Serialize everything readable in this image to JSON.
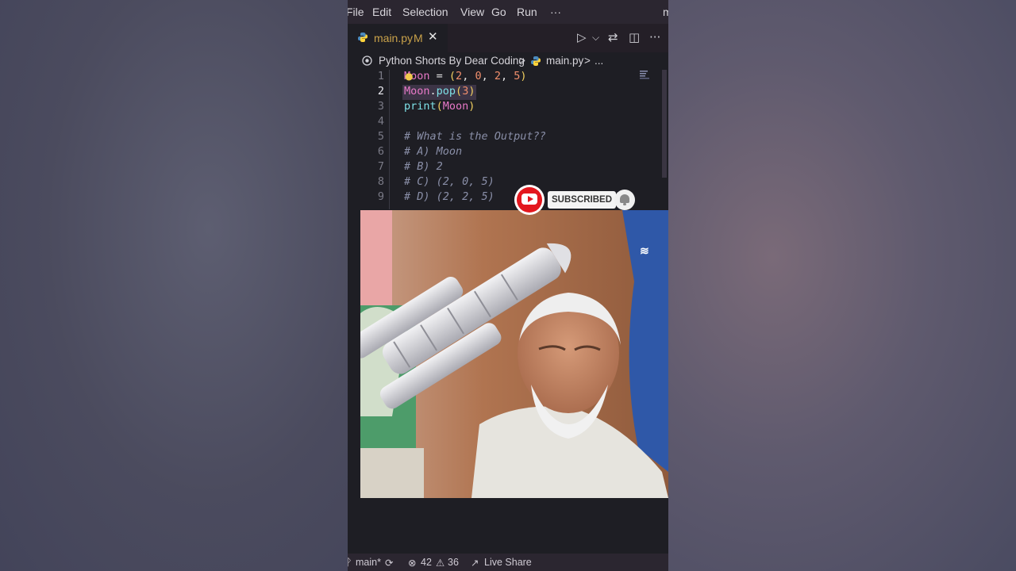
{
  "menubar": {
    "items": [
      "File",
      "Edit",
      "Selection",
      "View",
      "Go",
      "Run",
      "···"
    ],
    "trailing": "m"
  },
  "tab": {
    "filename": "main.py",
    "modified_badge": "M",
    "close_glyph": "✕"
  },
  "tab_actions": {
    "run_glyph": "▷",
    "run_menu_glyph": "⌵",
    "compare_glyph": "⇄",
    "split_glyph": "◫",
    "more_glyph": "···"
  },
  "breadcrumb": {
    "folder": "Python Shorts By Dear Coding",
    "separator": ">",
    "file": "main.py",
    "separator2": ">",
    "ellipsis": "..."
  },
  "editor": {
    "line_numbers": [
      "1",
      "2",
      "3",
      "4",
      "5",
      "6",
      "7",
      "8",
      "9"
    ],
    "active_line": "2",
    "lines": {
      "l1": {
        "var": "Moon",
        "eq": " = ",
        "open": "(",
        "v1": "2",
        "c1": ", ",
        "v2": "0",
        "c2": ", ",
        "v3": "2",
        "c3": ", ",
        "v4": "5",
        "close": ")"
      },
      "l2": {
        "obj": "Moon",
        "dot": ".",
        "method": "pop",
        "open": "(",
        "arg": "3",
        "close": ")"
      },
      "l3": {
        "fn": "print",
        "open": "(",
        "arg": "Moon",
        "close": ")"
      },
      "l5": "# What is the Output??",
      "l6": "# A) Moon",
      "l7": "# B) 2",
      "l8": "# C) (2, 0, 5)",
      "l9": "# D) (2, 2, 5)"
    }
  },
  "overlay": {
    "subscribe_text": "SUBSCRIBED"
  },
  "statusbar": {
    "branch": "main*",
    "errors": "42",
    "warnings": "36",
    "live_share": "Live Share"
  },
  "colors": {
    "editor_bg": "#1e1e24",
    "chrome_bg": "#2b2630",
    "youtube_red": "#e3171e",
    "modified_yellow": "#c9a24a"
  }
}
